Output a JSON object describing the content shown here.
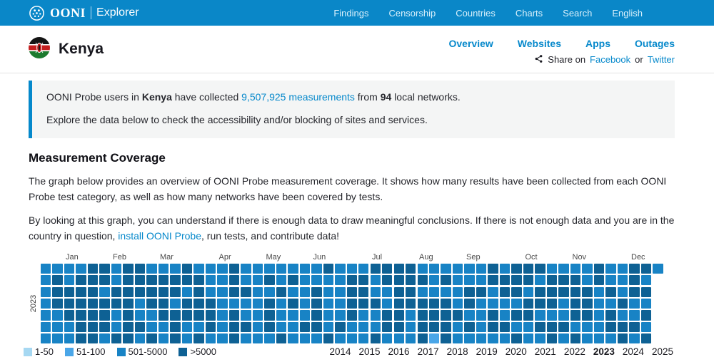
{
  "colors": {
    "accent": "#0588cb",
    "navbar_bg": "#0a87c8"
  },
  "navbar": {
    "brand_name": "OONI",
    "brand_product": "Explorer",
    "items": [
      "Findings",
      "Censorship",
      "Countries",
      "Charts",
      "Search",
      "English"
    ]
  },
  "country_header": {
    "name": "Kenya",
    "tabs": [
      "Overview",
      "Websites",
      "Apps",
      "Outages"
    ],
    "share_prefix": "Share on",
    "share_link1": "Facebook",
    "share_or": "or",
    "share_link2": "Twitter"
  },
  "intro": {
    "p1": {
      "t1": "OONI Probe users in ",
      "b1": "Kenya",
      "t2": " have collected ",
      "link": "9,507,925 measurements",
      "t3": " from ",
      "b2": "94",
      "t4": " local networks."
    },
    "p2": "Explore the data below to check the accessibility and/or blocking of sites and services."
  },
  "section": {
    "title": "Measurement Coverage",
    "para1": "The graph below provides an overview of OONI Probe measurement coverage. It shows how many results have been collected from each OONI Probe test category, as well as how many networks have been covered by tests.",
    "para2_pre": "By looking at this graph, you can understand if there is enough data to draw meaningful conclusions. If there is not enough data and you are in the country in question, ",
    "para2_link": "install OONI Probe",
    "para2_post": ", run tests, and contribute data!"
  },
  "chart_data": {
    "type": "heatmap",
    "title": "OONI Probe measurement coverage calendar heatmap for Kenya, year 2023",
    "year_label": "2023",
    "months": [
      "Jan",
      "Feb",
      "Mar",
      "Apr",
      "May",
      "Jun",
      "Jul",
      "Aug",
      "Sep",
      "Oct",
      "Nov",
      "Dec"
    ],
    "month_week_index": [
      2,
      6,
      10,
      15,
      19,
      23,
      28,
      32,
      36,
      41,
      45,
      50
    ],
    "weeks": 53,
    "weekday_rows": 7,
    "legend": [
      {
        "label": "1-50",
        "color": "#a6d8f2",
        "level": "1"
      },
      {
        "label": "51-100",
        "color": "#4aa6e8",
        "level": "2"
      },
      {
        "label": "501-5000",
        "color": "#1883c5",
        "level": "3"
      },
      {
        "label": ">5000",
        "color": "#0e6194",
        "level": "4"
      }
    ],
    "level_colors": {
      "1": "#a6d8f2",
      "2": "#4aa6e8",
      "3": "#1883c5",
      "4": "#0e6194"
    },
    "grid_rows": [
      [
        "3333443443334",
        "3334333333343",
        "3344443333334",
        "3444333343344",
        "3"
      ],
      [
        "3434443444444",
        "4334334343333",
        "4434444343334",
        "4443444343343"
      ],
      [
        "3444434444443",
        "4334433433433",
        "4433443333443",
        "4434444434344"
      ],
      [
        "3444444434434",
        "4433334343433",
        "4443444443433",
        "3344434433433"
      ],
      [
        "3344443433444",
        "4434334333433",
        "4334434444334",
        "3443334434334"
      ],
      [
        "3334443443343",
        "3434434334434",
        "3334434443434",
        "4334443334443"
      ],
      [
        "3334434434343",
        "4334333433343",
        "3343334243333",
        "3433434333434"
      ]
    ],
    "years": [
      "2014",
      "2015",
      "2016",
      "2017",
      "2018",
      "2019",
      "2020",
      "2021",
      "2022",
      "2023",
      "2024",
      "2025"
    ],
    "selected_year": "2023"
  }
}
